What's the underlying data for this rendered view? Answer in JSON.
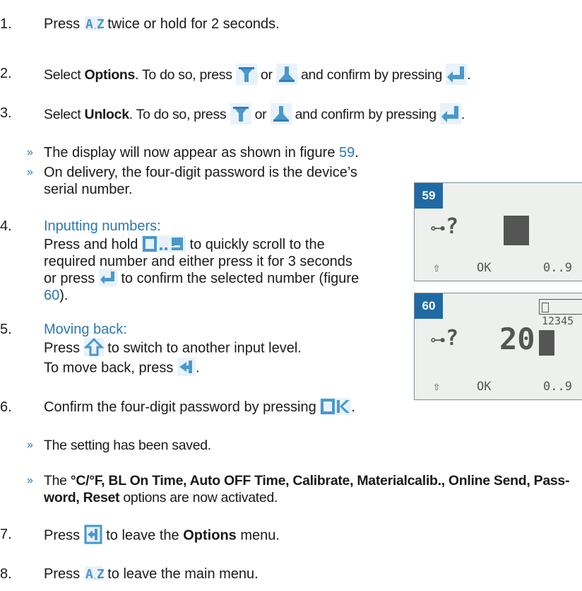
{
  "steps": {
    "s1": {
      "num": "1.",
      "pre": "Press",
      "post": "twice or hold for 2 seconds."
    },
    "s2": {
      "num": "2.",
      "pre": "Select",
      "bold": "Options",
      "mid": ". To do so, press",
      "or": "or",
      "post": "and confirm by pressing",
      "end": "."
    },
    "s3": {
      "num": "3.",
      "pre": "Select",
      "bold": "Unlock",
      "mid": ". To do so, press",
      "or": "or",
      "post": "and confirm by pressing",
      "end": "."
    },
    "r1": "The display will now appear as shown in figure",
    "r1_ref": "59",
    "r1_end": ".",
    "r2_line1": "On delivery, the four-digit password is the device’s",
    "r2_line2": "serial number.",
    "s4": {
      "num": "4.",
      "heading": "Inputting numbers:",
      "l1_pre": "Press and hold",
      "l1_post": "to quickly scroll to the",
      "l2": "required number and either press it for 3 seconds",
      "l3_pre": "or press",
      "l3_post": "to confirm the selected number (figure",
      "l4_ref": "60",
      "l4_end": ")."
    },
    "s5": {
      "num": "5.",
      "heading": "Moving back:",
      "l1_pre": "Press",
      "l1_post": "to switch to another input level.",
      "l2_pre": "To move back, press",
      "l2_end": "."
    },
    "s6": {
      "num": "6.",
      "pre": "Confirm the four-digit password by pressing",
      "end": "."
    },
    "r3": "The setting has been saved.",
    "r4_pre": "The",
    "r4_bold1": "°C/°F, BL On Time, Auto OFF Time, Calibrate, Materialcalib., Online Send, Pass-",
    "r4_bold2": "word, Reset",
    "r4_post": "options are now activated.",
    "s7": {
      "num": "7.",
      "pre": "Press",
      "mid": "to leave the",
      "bold": "Options",
      "post": "menu."
    },
    "s8": {
      "num": "8.",
      "pre": "Press",
      "post": "to leave the main menu."
    }
  },
  "figures": [
    {
      "label": "59",
      "prompt": "?",
      "ok": "OK",
      "range": "0..9"
    },
    {
      "label": "60",
      "prompt": "?",
      "value": "20",
      "serial": "12345",
      "ok": "OK",
      "range": "0..9"
    }
  ],
  "raquo": "»",
  "colors": {
    "blue": "#2a78b5",
    "badge": "#1f6aa5",
    "icon_blue": "#4a98cc"
  }
}
